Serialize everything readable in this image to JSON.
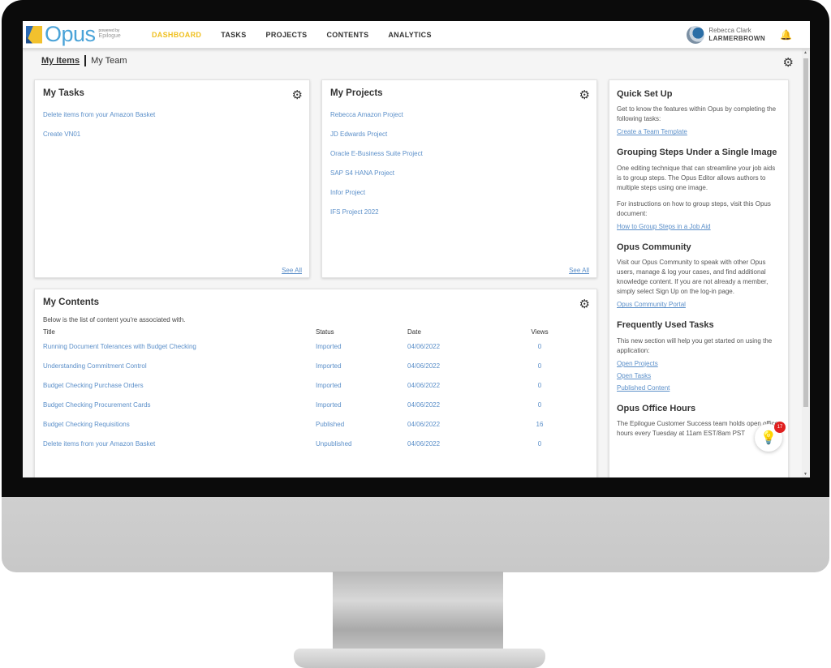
{
  "header": {
    "logo_text": "Opus",
    "logo_powered_by": "powered by",
    "logo_brand": "Epilogue",
    "nav": [
      {
        "label": "DASHBOARD",
        "active": true
      },
      {
        "label": "TASKS",
        "active": false
      },
      {
        "label": "PROJECTS",
        "active": false
      },
      {
        "label": "CONTENTS",
        "active": false
      },
      {
        "label": "ANALYTICS",
        "active": false
      }
    ],
    "user_name": "Rebecca Clark",
    "user_org": "LARMERBROWN",
    "bell_icon": "🔔"
  },
  "tabs": {
    "my_items": "My Items",
    "my_team": "My Team"
  },
  "icons": {
    "gear": "⚙",
    "bulb": "💡",
    "scroll_up": "▲",
    "scroll_down": "▼"
  },
  "my_tasks": {
    "title": "My Tasks",
    "items": [
      "Delete items from your Amazon Basket",
      "Create VN01"
    ],
    "see_all": "See All"
  },
  "my_projects": {
    "title": "My Projects",
    "items": [
      "Rebecca Amazon Project",
      "JD Edwards Project",
      "Oracle E-Business Suite Project",
      "SAP S4 HANA Project",
      "Infor Project",
      "IFS Project 2022"
    ],
    "see_all": "See All"
  },
  "my_contents": {
    "title": "My Contents",
    "description": "Below is the list of content you're associated with.",
    "columns": [
      "Title",
      "Status",
      "Date",
      "Views"
    ],
    "rows": [
      {
        "title": "Running Document Tolerances with Budget Checking",
        "status": "Imported",
        "date": "04/06/2022",
        "views": "0"
      },
      {
        "title": "Understanding Commitment Control",
        "status": "Imported",
        "date": "04/06/2022",
        "views": "0"
      },
      {
        "title": "Budget Checking Purchase Orders",
        "status": "Imported",
        "date": "04/06/2022",
        "views": "0"
      },
      {
        "title": "Budget Checking Procurement Cards",
        "status": "Imported",
        "date": "04/06/2022",
        "views": "0"
      },
      {
        "title": "Budget Checking Requisitions",
        "status": "Published",
        "date": "04/06/2022",
        "views": "16"
      },
      {
        "title": "Delete items from your Amazon Basket",
        "status": "Unpublished",
        "date": "04/06/2022",
        "views": "0"
      }
    ]
  },
  "side_panel": {
    "quick_setup": {
      "title": "Quick Set Up",
      "text": "Get to know the features within Opus by completing the following tasks:",
      "link": "Create a Team Template"
    },
    "grouping": {
      "title": "Grouping Steps Under a Single Image",
      "text": "One editing technique that can streamline your job aids is to group steps. The Opus Editor allows authors to multiple steps using one image.",
      "text2": "For instructions on how to group steps, visit this Opus document:",
      "link": "How to Group Steps in a Job Aid"
    },
    "community": {
      "title": "Opus Community",
      "text": "Visit our Opus Community to speak with other Opus users, manage & log your cases, and find additional knowledge content. If you are not already a member, simply select Sign Up on the log-in page.",
      "link": "Opus Community Portal"
    },
    "frequent": {
      "title": "Frequently Used Tasks",
      "text": "This new section will help you get started on using the application:",
      "links": [
        "Open Projects",
        "Open Tasks",
        "Published Content"
      ]
    },
    "office_hours": {
      "title": "Opus Office Hours",
      "text": "The Epilogue Customer Success team holds open office hours every Tuesday at 11am EST/8am PST"
    }
  },
  "tips_badge_count": "17"
}
